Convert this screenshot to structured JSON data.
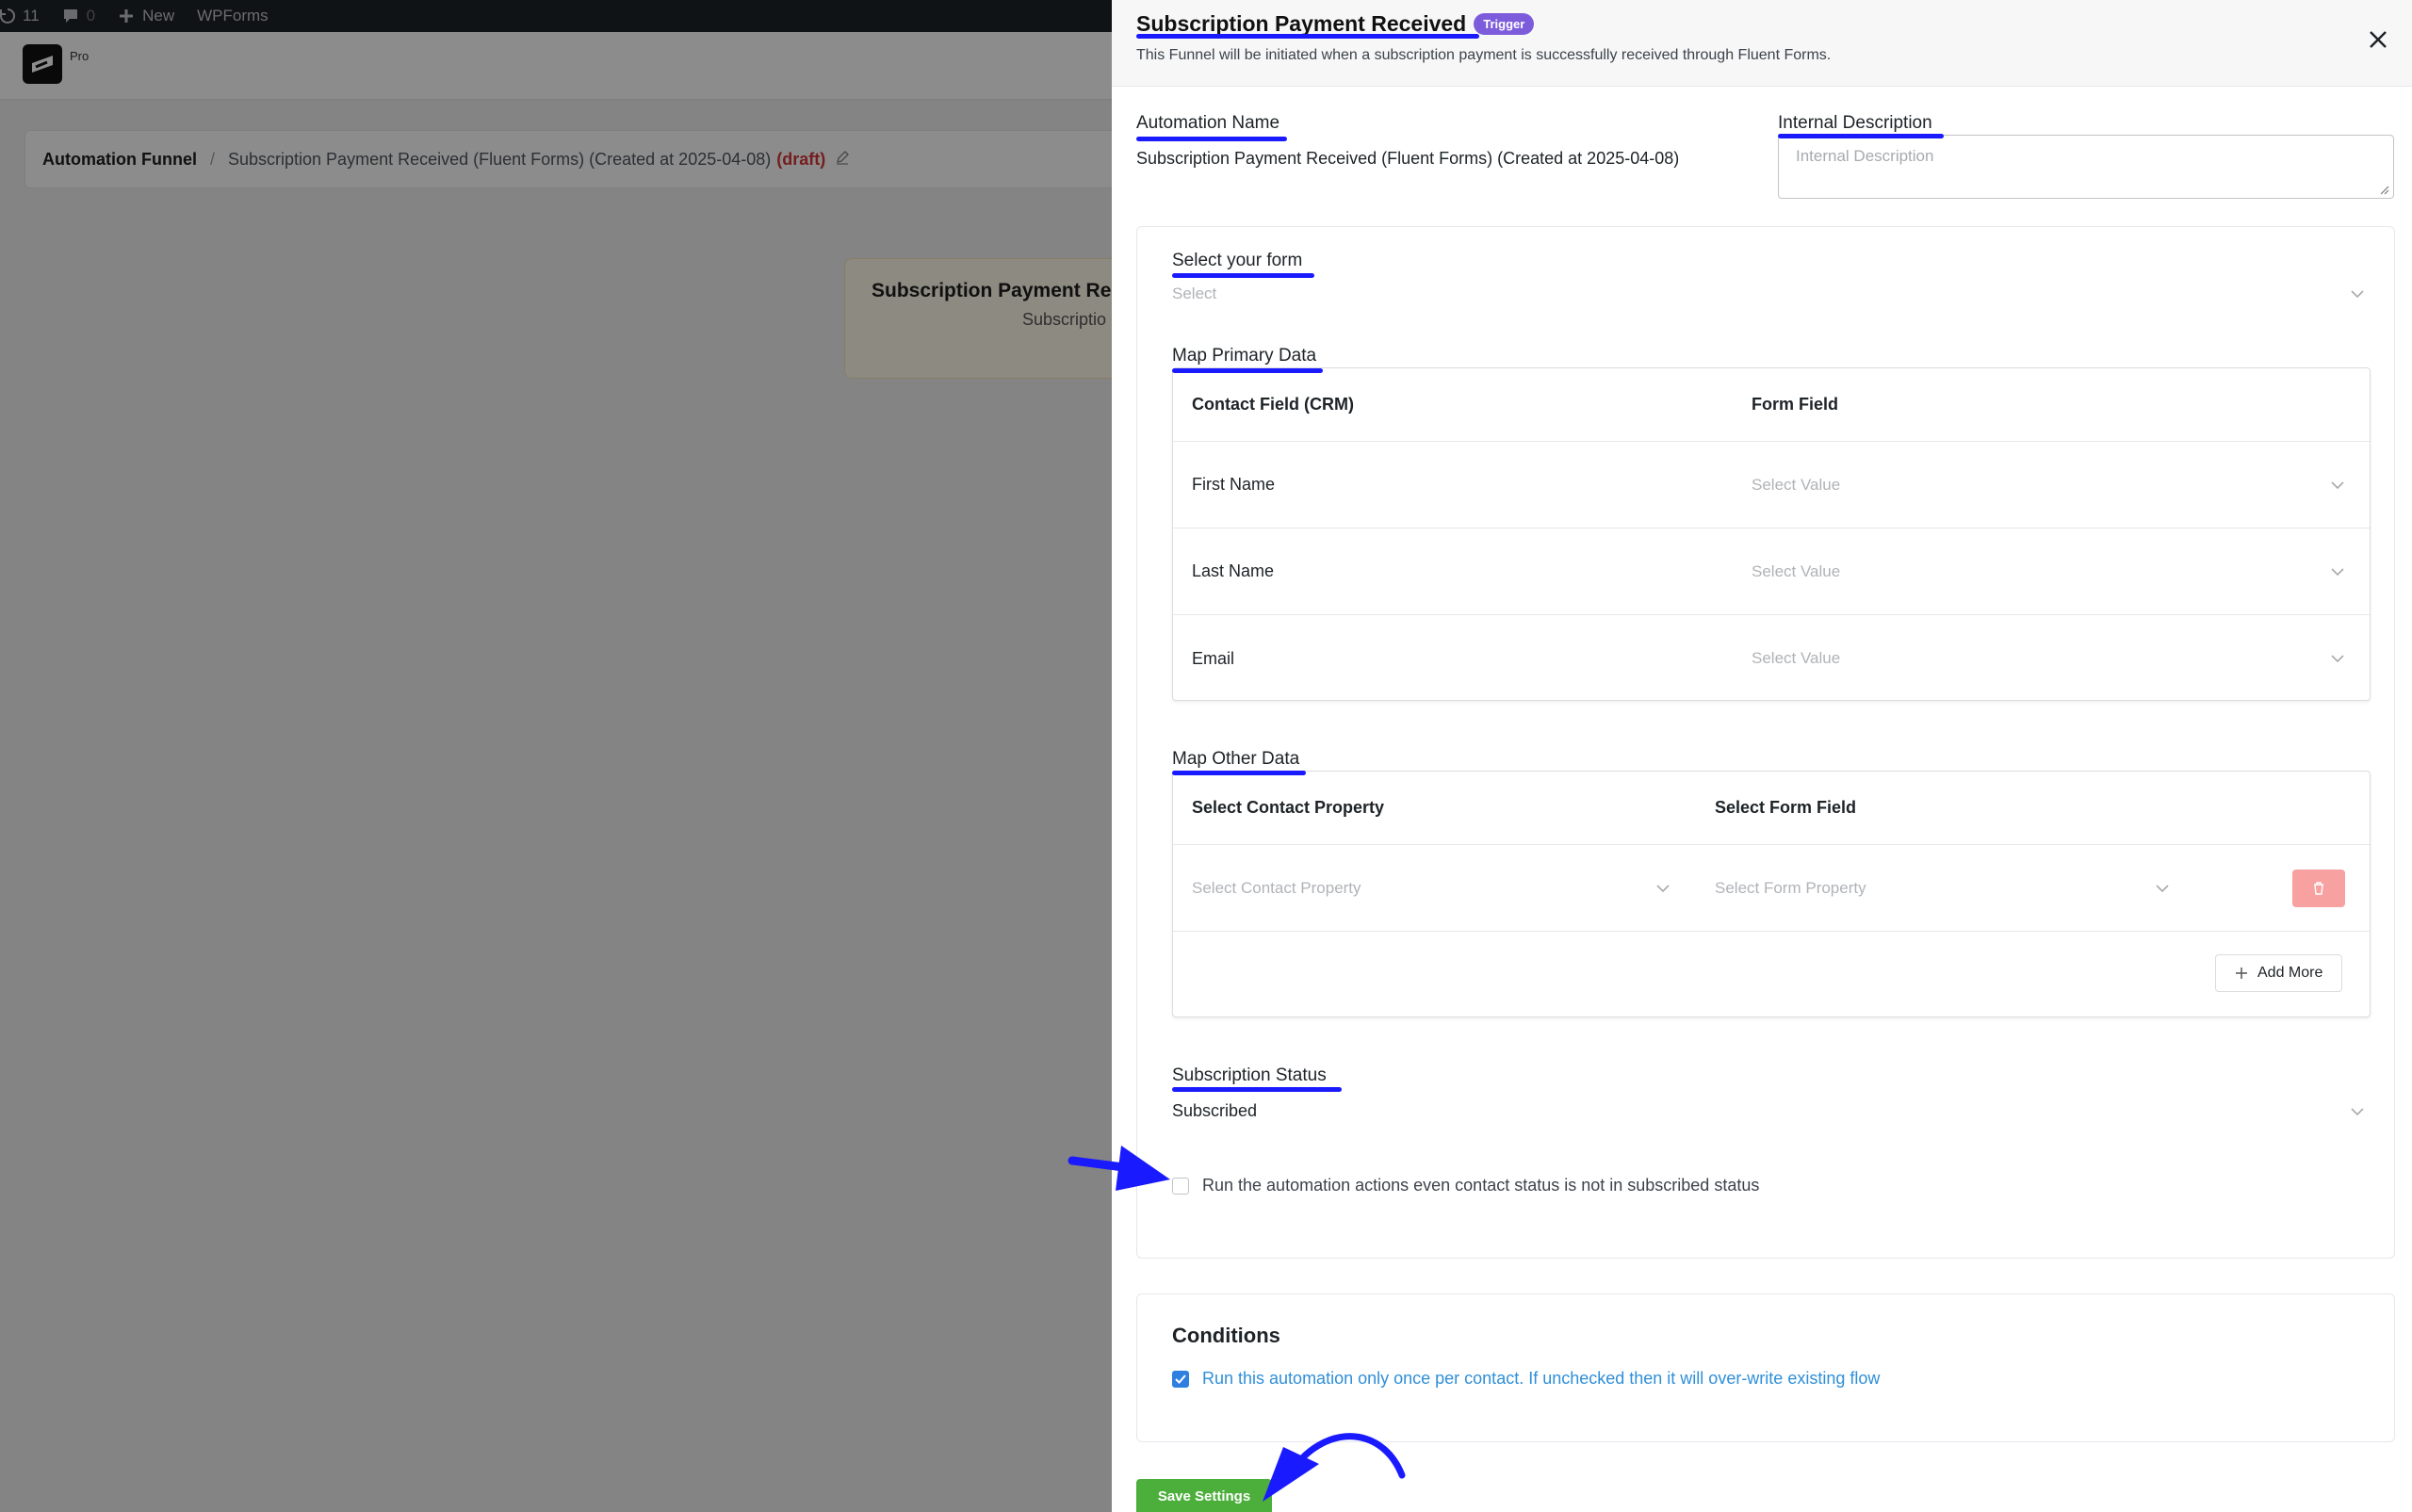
{
  "admin_bar": {
    "updates_count": "11",
    "comments_count": "0",
    "new_label": "New",
    "wpforms_label": "WPForms"
  },
  "plugin": {
    "pro_tag": "Pro"
  },
  "breadcrumb": {
    "root": "Automation Funnel",
    "separator": "/",
    "current": "Subscription Payment Received (Fluent Forms) (Created at 2025-04-08)",
    "status": "(draft)"
  },
  "canvas_card": {
    "title": "Subscription Payment Rec",
    "subtitle": "Subscriptio"
  },
  "drawer": {
    "title": "Subscription Payment Received",
    "badge": "Trigger",
    "subtitle": "This Funnel will be initiated when a subscription payment is successfully received through Fluent Forms.",
    "automation_name_label": "Automation Name",
    "automation_name_value": "Subscription Payment Received (Fluent Forms) (Created at 2025-04-08)",
    "internal_description_label": "Internal Description",
    "internal_description_placeholder": "Internal Description",
    "select_form_label": "Select your form",
    "select_form_placeholder": "Select",
    "map_primary_label": "Map Primary Data",
    "primary_headers": [
      "Contact Field (CRM)",
      "Form Field"
    ],
    "primary_rows": [
      {
        "field": "First Name",
        "value_placeholder": "Select Value"
      },
      {
        "field": "Last Name",
        "value_placeholder": "Select Value"
      },
      {
        "field": "Email",
        "value_placeholder": "Select Value"
      }
    ],
    "map_other_label": "Map Other Data",
    "other_headers": [
      "Select Contact Property",
      "Select Form Field"
    ],
    "other_row": {
      "property_placeholder": "Select Contact Property",
      "form_property_placeholder": "Select Form Property"
    },
    "add_more_label": "Add More",
    "subscription_status_label": "Subscription Status",
    "subscription_status_value": "Subscribed",
    "run_even_unsubscribed_label": "Run the automation actions even contact status is not in subscribed status",
    "run_even_unsubscribed_checked": false,
    "conditions_title": "Conditions",
    "run_once_label": "Run this automation only once per contact. If unchecked then it will over-write existing flow",
    "run_once_checked": true,
    "save_label": "Save Settings"
  },
  "colors": {
    "trigger_badge": "#7c5cdb",
    "annotation": "#1a1aff",
    "save_button": "#4caf3b",
    "checkbox_checked": "#2f7fe0",
    "draft": "#d63638"
  },
  "icons": [
    "updates-icon",
    "comment-icon",
    "plus-icon",
    "close-icon",
    "chevron-down-icon",
    "trash-icon",
    "edit-icon",
    "check-icon"
  ]
}
